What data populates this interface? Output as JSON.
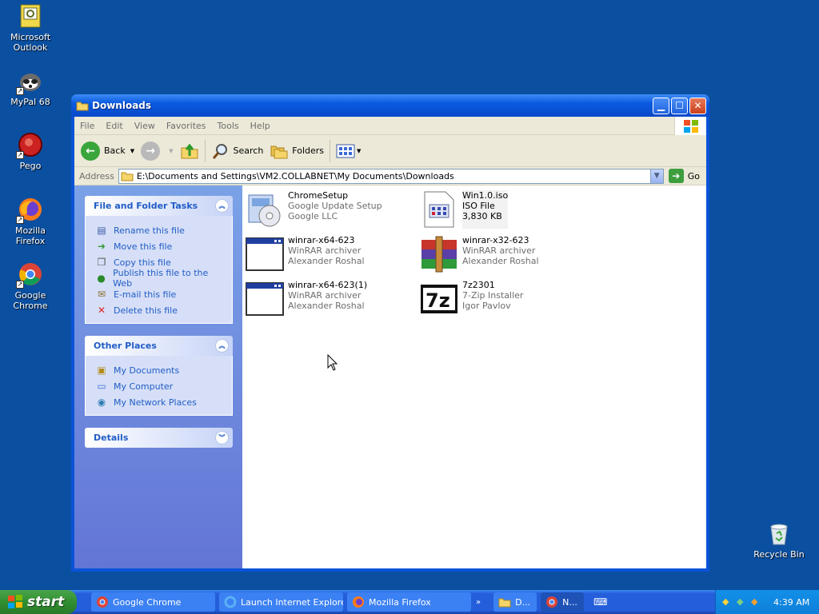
{
  "desktop": {
    "icons": [
      {
        "label": "Microsoft Outlook",
        "icon": "outlook-icon"
      },
      {
        "label": "MyPal 68",
        "icon": "mypal-icon"
      },
      {
        "label": "Pego",
        "icon": "pego-icon"
      },
      {
        "label": "Mozilla Firefox",
        "icon": "firefox-icon"
      },
      {
        "label": "Google Chrome",
        "icon": "chrome-icon"
      },
      {
        "label": "Recycle Bin",
        "icon": "recycle-bin-icon"
      }
    ]
  },
  "window": {
    "title": "Downloads",
    "menu": [
      "File",
      "Edit",
      "View",
      "Favorites",
      "Tools",
      "Help"
    ],
    "toolbar": {
      "back": "Back",
      "search": "Search",
      "folders": "Folders"
    },
    "address": {
      "label": "Address",
      "value": "E:\\Documents and Settings\\VM2.COLLABNET\\My Documents\\Downloads",
      "go": "Go"
    },
    "tasks": {
      "file_folder": {
        "title": "File and Folder Tasks",
        "items": [
          "Rename this file",
          "Move this file",
          "Copy this file",
          "Publish this file to the Web",
          "E-mail this file",
          "Delete this file"
        ]
      },
      "other_places": {
        "title": "Other Places",
        "items": [
          "My Documents",
          "My Computer",
          "My Network Places"
        ]
      },
      "details": {
        "title": "Details"
      }
    },
    "files": [
      {
        "name": "ChromeSetup",
        "line2": "Google Update Setup",
        "line3": "Google LLC"
      },
      {
        "name": "Win1.0.iso",
        "line2": "ISO File",
        "line3": "3,830 KB"
      },
      {
        "name": "winrar-x64-623",
        "line2": "WinRAR archiver",
        "line3": "Alexander Roshal"
      },
      {
        "name": "winrar-x32-623",
        "line2": "WinRAR archiver",
        "line3": "Alexander Roshal"
      },
      {
        "name": "winrar-x64-623(1)",
        "line2": "WinRAR archiver",
        "line3": "Alexander Roshal"
      },
      {
        "name": "7z2301",
        "line2": "7-Zip Installer",
        "line3": "Igor Pavlov"
      }
    ]
  },
  "taskbar": {
    "start": "start",
    "tasks": [
      "Google Chrome",
      "Launch Internet Explorer...",
      "Mozilla Firefox",
      "D...",
      "N..."
    ],
    "clock": "4:39 AM"
  },
  "colors": {
    "desktop": "#0b4fa0",
    "title": "#0a5ae0",
    "link": "#215dc6"
  }
}
